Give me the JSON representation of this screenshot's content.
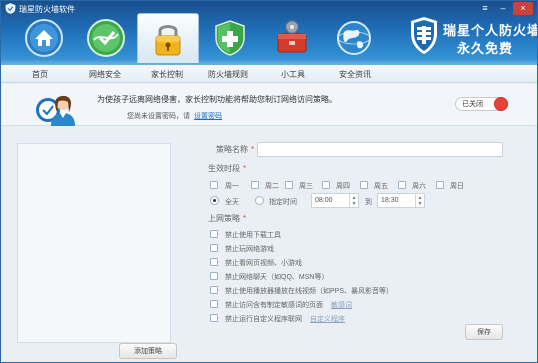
{
  "window": {
    "title": "瑞星防火墙软件",
    "controls": [
      "≡",
      "–",
      "×"
    ]
  },
  "brand": {
    "line1": "瑞星个人防火墙",
    "line2": "永久免费"
  },
  "nav": {
    "icons": [
      "home-icon",
      "network-shield-icon",
      "lock-icon",
      "shield-plus-icon",
      "toolbox-icon",
      "globe-icon"
    ],
    "active_index": 2,
    "tabs": [
      "首页",
      "网络安全",
      "家长控制",
      "防火墙规则",
      "小工具",
      "安全资讯"
    ]
  },
  "info": {
    "message": "为使孩子远离网络侵害，家长控制功能将帮助您制订网络访问策略。",
    "password_prompt": "您尚未设置密码，请",
    "password_link": "设置密码",
    "toggle_label": "已关闭",
    "toggle_color": "#e8413a"
  },
  "left_panel": {
    "add_button": "添加策略"
  },
  "form": {
    "policy_name_label": "策略名称",
    "policy_name_value": "",
    "time_label": "生效时段",
    "days": [
      "周一",
      "周二",
      "周三",
      "周四",
      "周五",
      "周六",
      "周日"
    ],
    "all_day_label": "全天",
    "specified_time_label": "指定时间",
    "start_time": "08:00",
    "to_label": "到",
    "end_time": "18:30",
    "rules_label": "上网策略",
    "rules": [
      {
        "text": "禁止使用下载工具"
      },
      {
        "text": "禁止玩网络游戏"
      },
      {
        "text": "禁止看网页视频、小游戏"
      },
      {
        "text": "禁止网络聊天（如QQ、MSN等）"
      },
      {
        "text": "禁止使用播放器播放在线视频（如PPS、暴风影音等）"
      },
      {
        "text": "禁止访问含有制定敏感词的页面",
        "link": "敏感词"
      },
      {
        "text": "禁止运行自定义程序联网",
        "link": "自定义程序"
      }
    ],
    "save_button": "保存"
  }
}
